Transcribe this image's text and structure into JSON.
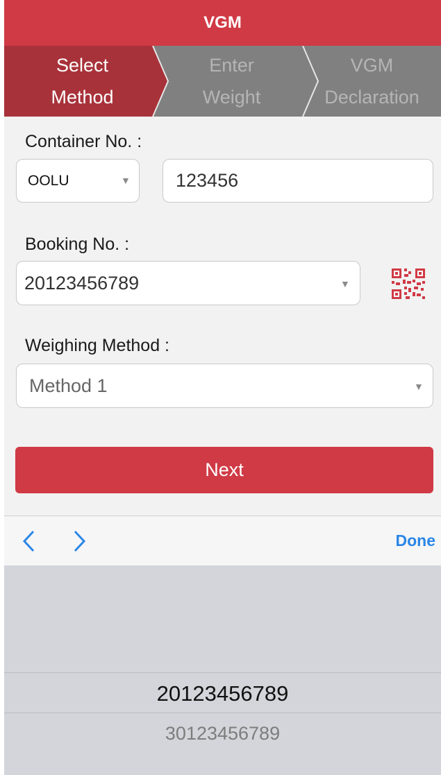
{
  "header": {
    "title": "VGM"
  },
  "steps": [
    {
      "label": "Select\nMethod",
      "active": true
    },
    {
      "label": "Enter\nWeight",
      "active": false
    },
    {
      "label": "VGM\nDeclaration",
      "active": false
    }
  ],
  "form": {
    "container_label": "Container No. :",
    "container_prefix": "OOLU",
    "container_number": "123456",
    "booking_label": "Booking No. :",
    "booking_value": "20123456789",
    "weighing_label": "Weighing Method :",
    "weighing_value": "Method 1"
  },
  "next_button": {
    "label": "Next"
  },
  "accessory": {
    "done_label": "Done",
    "prev_icon": "chevron-left-icon",
    "next_icon": "chevron-right-icon"
  },
  "picker": {
    "selected": "20123456789",
    "options_below": [
      "30123456789"
    ]
  },
  "colors": {
    "brand": "#d03a45",
    "link": "#2a86e6"
  }
}
